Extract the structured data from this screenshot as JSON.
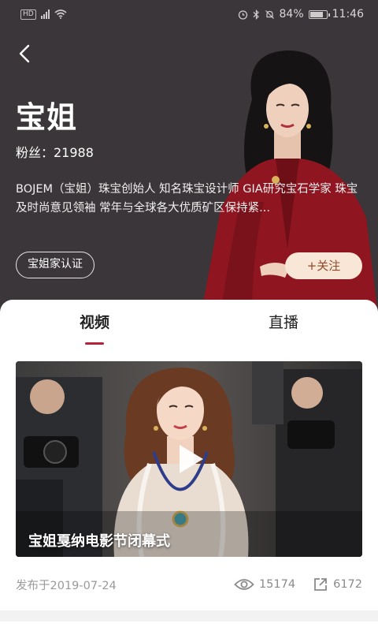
{
  "status_bar": {
    "network": "HD",
    "battery": "84%",
    "time": "11:46"
  },
  "profile": {
    "name": "宝姐",
    "fans": "粉丝：21988",
    "bio": "BOJEM（宝姐）珠宝创始人  知名珠宝设计师  GIA研究宝石学家  珠宝及时尚意见领袖  常年与全球各大优质矿区保持紧...",
    "verify_tag": "宝姐家认证",
    "follow_label": "+关注"
  },
  "tabs": [
    {
      "label": "视频",
      "active": true
    },
    {
      "label": "直播",
      "active": false
    }
  ],
  "video": {
    "title": "宝姐戛纳电影节闭幕式",
    "published": "发布于2019-07-24",
    "views": "15174",
    "shares": "6172"
  },
  "colors": {
    "hero_bg": "#3a3639",
    "accent": "#b3243b",
    "follow_bg": "#f8e7d6"
  },
  "icons": [
    "back-arrow-icon",
    "play-icon",
    "eye-icon",
    "share-icon"
  ]
}
